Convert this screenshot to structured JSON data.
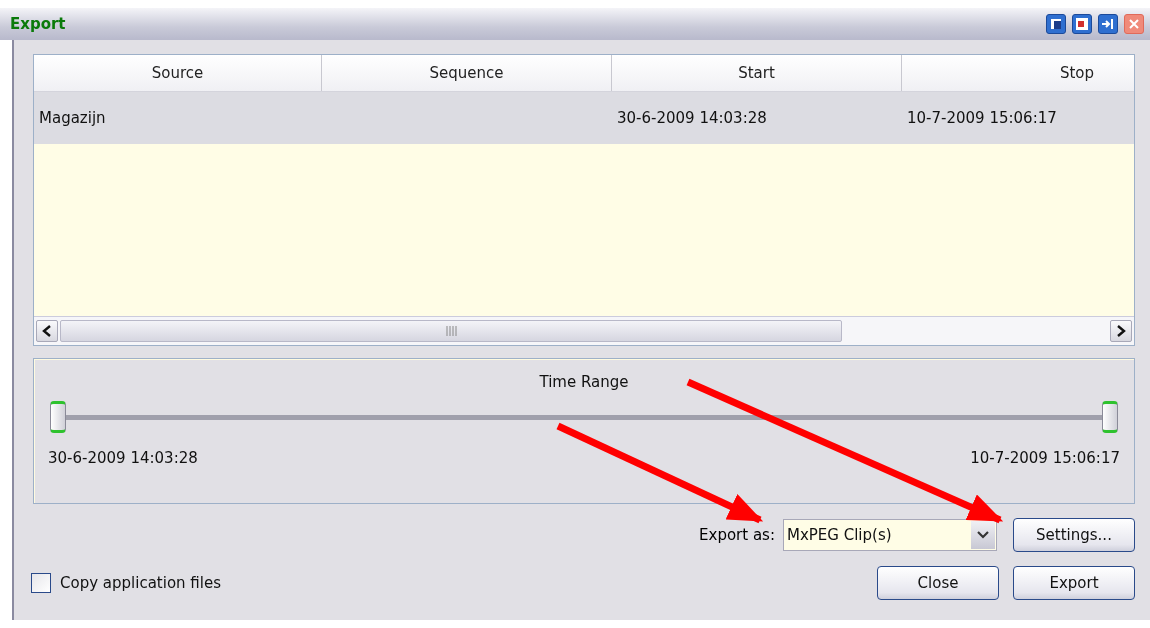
{
  "window": {
    "title": "Export",
    "title_buttons": [
      {
        "kind": "restore"
      },
      {
        "kind": "layout"
      },
      {
        "kind": "pin"
      },
      {
        "kind": "close"
      }
    ]
  },
  "table": {
    "columns": [
      "Source",
      "Sequence",
      "Start",
      "Stop"
    ],
    "rows": [
      {
        "selected": true,
        "source": "Magazijn",
        "start": "30-6-2009 14:03:28",
        "stop": "10-7-2009 15:06:17"
      }
    ]
  },
  "time_range": {
    "title": "Time Range",
    "handles": [
      {
        "level": 0
      },
      {
        "level": 1
      }
    ],
    "start_label": "30-6-2009 14:03:28",
    "end_label": "10-7-2009 15:06:17"
  },
  "export_as": {
    "label": "Export as:",
    "value": "MxPEG Clip(s)",
    "settings_button": "Settings..."
  },
  "copy_application_files": {
    "label": "Copy application files",
    "checked": false
  },
  "buttons": [
    "Close",
    "Export"
  ]
}
